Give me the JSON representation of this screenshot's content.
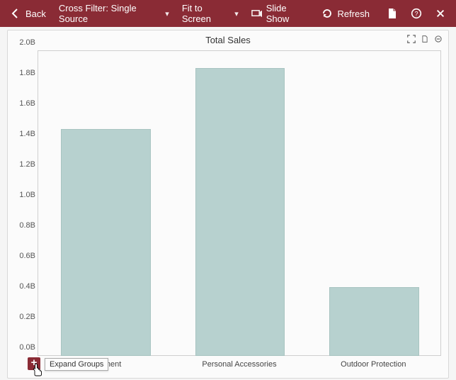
{
  "toolbar": {
    "back_label": "Back",
    "cross_filter_label": "Cross Filter: Single Source",
    "fit_label": "Fit to Screen",
    "slideshow_label": "Slide Show",
    "refresh_label": "Refresh"
  },
  "chart_title": "Total Sales",
  "expand_tooltip": "Expand Groups",
  "chart_data": {
    "type": "bar",
    "title": "Total Sales",
    "xlabel": "",
    "ylabel": "",
    "categories": [
      "Equipment",
      "Personal Accessories",
      "Outdoor Protection"
    ],
    "values": [
      1.48,
      1.88,
      0.44
    ],
    "value_unit": "B",
    "yticks": [
      0.0,
      0.2,
      0.4,
      0.6,
      0.8,
      1.0,
      1.2,
      1.4,
      1.6,
      1.8,
      2.0
    ],
    "ytick_labels": [
      "0.0B",
      "0.2B",
      "0.4B",
      "0.6B",
      "0.8B",
      "1.0B",
      "1.2B",
      "1.4B",
      "1.6B",
      "1.8B",
      "2.0B"
    ],
    "ylim": [
      0,
      2.0
    ],
    "category_label_overrides": {
      "0": "quipment"
    },
    "colors": {
      "bar_fill": "#b7d1cf",
      "bar_border": "#a8c4c1",
      "accent": "#8a2b35"
    }
  }
}
